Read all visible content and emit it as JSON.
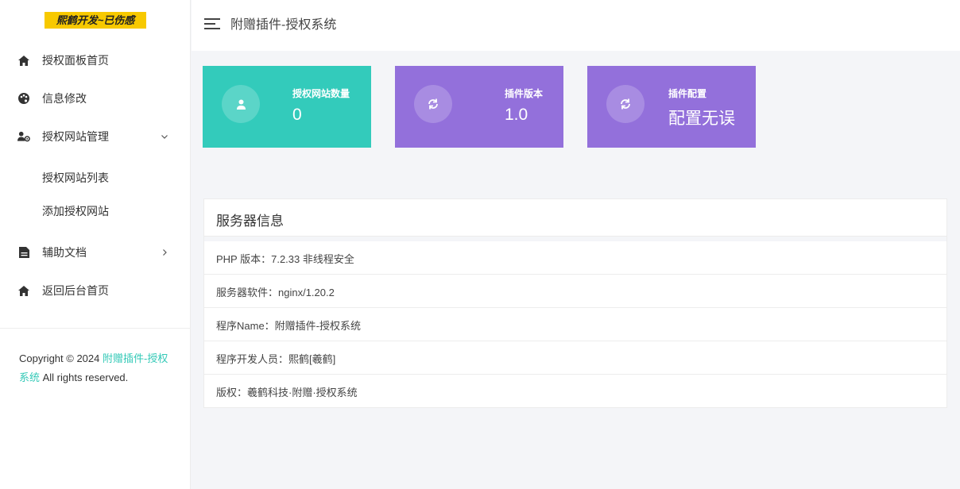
{
  "sidebar": {
    "logo_text": "熙鹤开发~已伤感",
    "items": [
      {
        "label": "授权面板首页"
      },
      {
        "label": "信息修改"
      },
      {
        "label": "授权网站管理"
      },
      {
        "label": "辅助文档"
      },
      {
        "label": "返回后台首页"
      }
    ],
    "sub_items": [
      {
        "label": "授权网站列表"
      },
      {
        "label": "添加授权网站"
      }
    ],
    "copyright_prefix": "Copyright © 2024 ",
    "copyright_link": "附赠插件-授权系统",
    "copyright_suffix": " All rights reserved."
  },
  "header": {
    "title": "附赠插件-授权系统"
  },
  "cards": [
    {
      "label": "授权网站数量",
      "value": "0",
      "color": "#33cbbb",
      "icon": "user-icon"
    },
    {
      "label": "插件版本",
      "value": "1.0",
      "color": "#9370db",
      "icon": "refresh-icon"
    },
    {
      "label": "插件配置",
      "value": "配置无误",
      "color": "#9370db",
      "icon": "refresh-icon"
    }
  ],
  "server_info": {
    "title": "服务器信息",
    "rows": [
      {
        "text": "PHP 版本：7.2.33 非线程安全"
      },
      {
        "text": "服务器软件：nginx/1.20.2"
      },
      {
        "text": "程序Name：附赠插件-授权系统"
      },
      {
        "text": "程序开发人员：熙鹤[羲鹤]"
      },
      {
        "text": "版权：羲鹤科技·附赠·授权系统"
      }
    ]
  },
  "colors": {
    "accent_teal": "#33cbbb",
    "accent_purple": "#9370db",
    "logo_yellow": "#f7c900"
  }
}
